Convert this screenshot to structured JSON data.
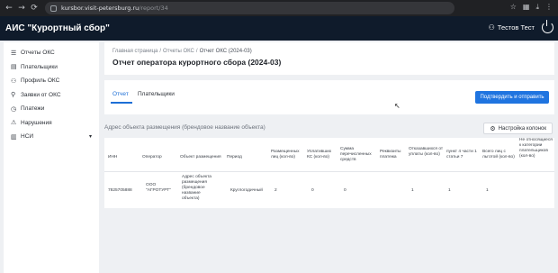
{
  "browser": {
    "back": "←",
    "forward": "→",
    "reload": "⟳",
    "url_host": "kursbor.visit-petersburg.ru",
    "url_path": "/report/34",
    "icons": [
      "star-icon",
      "extensions-icon",
      "download-icon",
      "menu-icon"
    ]
  },
  "app": {
    "title": "АИС \"Курортный сбор\"",
    "user_name": "Тестов Тест"
  },
  "sidebar": {
    "items": [
      {
        "label": "Отчеты ОКС",
        "icon": "list-icon"
      },
      {
        "label": "Плательщики",
        "icon": "document-icon"
      },
      {
        "label": "Профиль ОКС",
        "icon": "user-icon"
      },
      {
        "label": "Заявки от ОКС",
        "icon": "request-icon"
      },
      {
        "label": "Платежи",
        "icon": "clock-icon"
      },
      {
        "label": "Нарушения",
        "icon": "warning-icon"
      },
      {
        "label": "НСИ",
        "icon": "database-icon"
      }
    ]
  },
  "breadcrumb": {
    "home": "Главная страница",
    "reports": "Отчеты ОКС",
    "current": "Отчет ОКС (2024-03)"
  },
  "page_title": "Отчет оператора курортного сбора (2024-03)",
  "tabs": [
    {
      "label": "Отчет",
      "active": true
    },
    {
      "label": "Плательщики",
      "active": false
    }
  ],
  "submit_button": "Подтвердить и отправить",
  "table_section": {
    "title": "Адрес объекта размещения (брендовое название объекта)",
    "settings_button": "Настройка колонок"
  },
  "table": {
    "columns": [
      "ИНН",
      "Оператор",
      "Объект размещения",
      "Период",
      "Размещенных лиц (кол-во)",
      "Уплативших КС (кол-во)",
      "Сумма перечисленных средств",
      "Реквизиты платежа",
      "Отказавшихся от уплаты (кол-во)",
      "пункт 4 части 1 статьи 7",
      "Всего лиц с льготой (кол-во)",
      "Не относящиеся к категории плательщиков (кол-во)"
    ],
    "rows": [
      {
        "inn": "7825705888",
        "operator": "ООО \"АГРОТУРТ\"",
        "object": "Адрес объекта размещения (брендовое название объекта)",
        "period": "Круглогодичный",
        "placed": "2",
        "paid": "0",
        "sum": "0",
        "refused": "1",
        "p4": "1",
        "benefit": "1"
      }
    ]
  }
}
